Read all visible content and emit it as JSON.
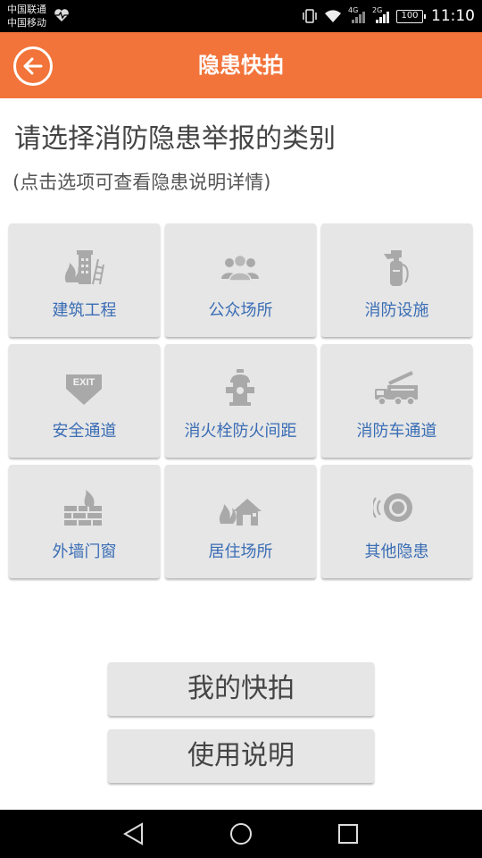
{
  "status_bar": {
    "carrier_1": "中国联通",
    "carrier_2": "中国移动",
    "network_1": "4G",
    "network_2": "2G",
    "battery": "100",
    "time": "11:10"
  },
  "header": {
    "title": "隐患快拍",
    "back_icon": "arrow-left-circle-icon",
    "background_color": "#f2743a"
  },
  "main": {
    "headline": "请选择消防隐患举报的类别",
    "subline": "(点击选项可查看隐患说明详情)"
  },
  "categories": [
    {
      "label": "建筑工程",
      "icon": "construction-building-icon"
    },
    {
      "label": "公众场所",
      "icon": "people-crowd-icon"
    },
    {
      "label": "消防设施",
      "icon": "fire-extinguisher-icon"
    },
    {
      "label": "安全通道",
      "icon": "exit-sign-icon"
    },
    {
      "label": "消火栓防火间距",
      "icon": "fire-hydrant-icon"
    },
    {
      "label": "消防车通道",
      "icon": "fire-truck-icon"
    },
    {
      "label": "外墙门窗",
      "icon": "burning-wall-icon"
    },
    {
      "label": "居住场所",
      "icon": "burning-house-icon"
    },
    {
      "label": "其他隐患",
      "icon": "alarm-bell-icon"
    }
  ],
  "actions": {
    "my_snaps": "我的快拍",
    "instructions": "使用说明"
  },
  "icon_text": {
    "exit": "EXIT"
  },
  "colors": {
    "label_blue": "#3a6db5",
    "icon_gray": "#a9a9a9",
    "tile_bg": "#e6e6e6"
  }
}
